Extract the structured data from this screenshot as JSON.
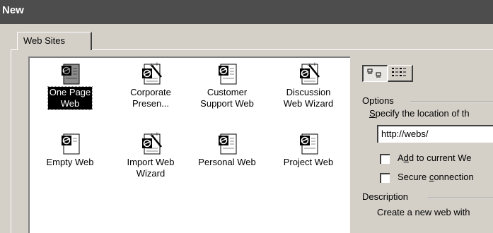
{
  "window": {
    "title": "New"
  },
  "tabs": [
    {
      "label": "Web Sites"
    }
  ],
  "templates": [
    {
      "name": "One Page Web",
      "line1": "One Page",
      "line2": "Web",
      "icon": "web-page-icon",
      "selected": true
    },
    {
      "name": "Corporate Presen...",
      "line1": "Corporate",
      "line2": "Presen...",
      "icon": "wizard-wand-icon",
      "selected": false
    },
    {
      "name": "Customer Support Web",
      "line1": "Customer",
      "line2": "Support Web",
      "icon": "web-page-icon",
      "selected": false
    },
    {
      "name": "Discussion Web Wizard",
      "line1": "Discussion",
      "line2": "Web Wizard",
      "icon": "wizard-wand-icon",
      "selected": false
    },
    {
      "name": "Empty Web",
      "line1": "Empty Web",
      "line2": "",
      "icon": "web-page-icon",
      "selected": false
    },
    {
      "name": "Import Web Wizard",
      "line1": "Import Web",
      "line2": "Wizard",
      "icon": "wizard-wand-icon",
      "selected": false
    },
    {
      "name": "Personal Web",
      "line1": "Personal Web",
      "line2": "",
      "icon": "web-page-icon",
      "selected": false
    },
    {
      "name": "Project Web",
      "line1": "Project Web",
      "line2": "",
      "icon": "web-page-icon",
      "selected": false
    }
  ],
  "view_buttons": [
    {
      "name": "large-icons-view",
      "icon": "large-icons-icon",
      "pressed": true
    },
    {
      "name": "list-view",
      "icon": "list-view-icon",
      "pressed": false
    }
  ],
  "options": {
    "group_label": "Options",
    "location_prefix": "S",
    "location_rest": "pecify the location of th",
    "location_value": "http://webs/",
    "add_pre": "A",
    "add_u": "d",
    "add_post": "d to current We",
    "secure_pre": "Secure ",
    "secure_u": "c",
    "secure_post": "onnection"
  },
  "description": {
    "group_label": "Description",
    "text": "Create a new web with"
  },
  "colors": {
    "titlebar": "#4d4d4d",
    "face": "#d4d0c8",
    "selection": "#000000"
  }
}
